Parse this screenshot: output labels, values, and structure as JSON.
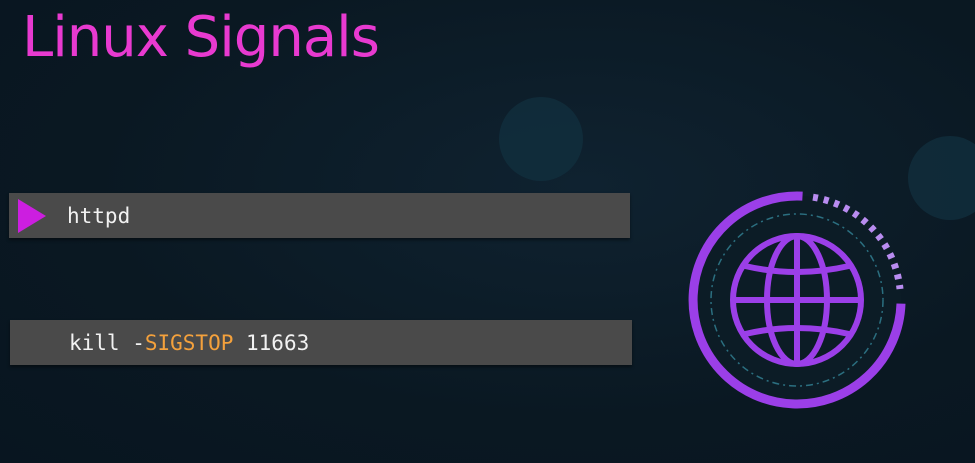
{
  "slide": {
    "title": "Linux Signals"
  },
  "commands": [
    {
      "text": "httpd",
      "has_play_icon": true
    },
    {
      "prefix": "kill -",
      "signal": "SIGSTOP",
      "suffix": " 11663",
      "has_play_icon": false
    }
  ],
  "icons": {
    "prompt": "play-triangle-icon",
    "network": "globe-icon"
  },
  "colors": {
    "title": "#e83ad0",
    "play_icon": "#cc1ee0",
    "signal_keyword": "#f4a13c",
    "globe": "#9b3fe8",
    "command_bar": "#4a4a4a"
  }
}
